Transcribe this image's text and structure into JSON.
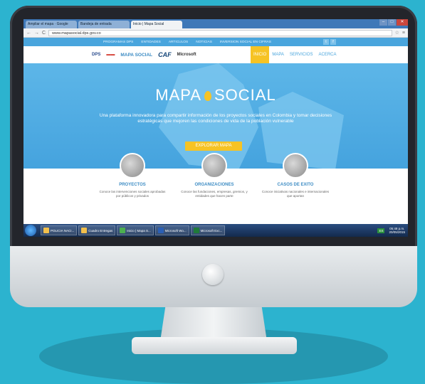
{
  "browser": {
    "tabs": [
      {
        "label": "Ampliar el mapa · Google"
      },
      {
        "label": "Bandeja de entrada"
      },
      {
        "label": "Inicio | Mapa Social",
        "active": true
      }
    ],
    "url": "www.mapasocial.dps.gov.co"
  },
  "site": {
    "topnav": [
      "PROGRAMAS DPS",
      "ENTIDADES",
      "ARTICULOS",
      "NOTICIAS",
      "INVERSION SOCIAL EN CIFRAS"
    ],
    "logos": {
      "dps": "DPS",
      "colombia": "TODOS POR UN NUEVO PAIS",
      "mapa": "MAPA SOCIAL",
      "caf": "CAF",
      "microsoft": "Microsoft"
    },
    "menu": [
      {
        "label": "INICIO",
        "active": true
      },
      {
        "label": "MAPA"
      },
      {
        "label": "SERVICIOS"
      },
      {
        "label": "ACERCA"
      }
    ],
    "hero": {
      "brand_left": "MAPA",
      "brand_right": "SOCIAL",
      "tagline": "Una plataforma innovadora para compartir información de los proyectos sociales en Colombia y tomar decisiones estratégicas que mejoren las condiciones de vida de la población vulnerable",
      "cta": "EXPLORAR MAPA"
    },
    "features": [
      {
        "title": "PROYECTOS",
        "desc": "Conoce las intervenciones sociales aprobadas por públicos y privados"
      },
      {
        "title": "ORGANIZACIONES",
        "desc": "Conoce las fundaciones, empresas, gremios, y entidades que hacen parte"
      },
      {
        "title": "CASOS DE EXITO",
        "desc": "Conoce iniciativas nacionales e internacionales que aportan"
      }
    ]
  },
  "taskbar": {
    "items": [
      "POLICIA NACI...",
      "Cuadro Entregas",
      "Inicio | Mapa S...",
      "Microsoft Wo...",
      "Microsoft Exc..."
    ],
    "lang": "ES",
    "time": "05:48 p.m.",
    "date": "20/05/2015"
  },
  "colors": {
    "accent": "#49a5dd",
    "highlight": "#f6c324",
    "background": "#2cb3cf"
  }
}
